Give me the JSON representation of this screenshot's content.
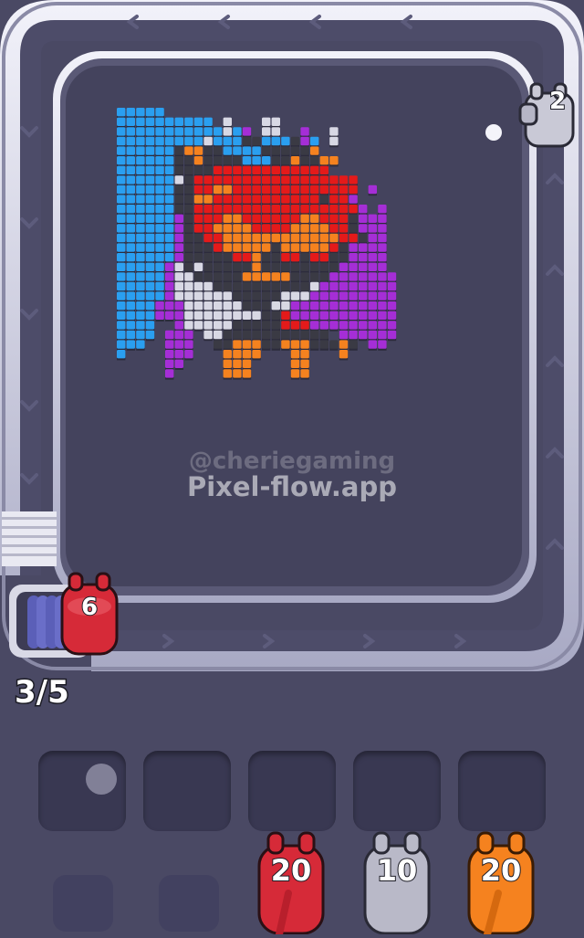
{
  "watermark": {
    "handle": "@cheriegaming",
    "site": "Pixel-flow.app"
  },
  "conveyor": {
    "shooter": {
      "count": "2",
      "color": "#b9b9c8"
    },
    "active_shooter": {
      "count": "6",
      "color": "#d62a38"
    },
    "progress": "3/5"
  },
  "queue_units": [
    {
      "count": "20",
      "color": "#d62a38"
    },
    {
      "count": "10",
      "color": "#b9b9c8"
    },
    {
      "count": "20",
      "color": "#f5821f"
    }
  ],
  "slots": {
    "count": 5
  },
  "palette": {
    "B": "#2a9ff0",
    "D": "#3a3a44",
    "W": "#d8d8e4",
    "O": "#f5821f",
    "R": "#e41a1a",
    "P": "#a52ed6"
  },
  "pixel_art": [
    "BBBBB.........................",
    "BBBBBBBBBB.W...WW.............",
    "BBBBBBBBBBBWBP.WW..P..W.......",
    "BBBBBBBBBWBBBDDBBBDPB.W.......",
    "BBBBBBDOODDBBBBDDDDDO.........",
    "BBBBBBDDODDDDBBBDDODDOO.......",
    "BBBBBBDDDDRRRRRRRRRRRR........",
    "BBBBBBWDRRRRRRRRRRRRRRRRR.....",
    "BBBBBBDDRROORRRRRRRRRRRRR.P...",
    "BBBBBBDDOORRRRRRRRRRRDRRP.....",
    "BBBBBBDDRRRRRRRRRRRRRRRRRP.P..",
    "BBBBBBPDRRROORRRRRROORRRDPPP..",
    "BBBBBBPDRROOOORRRROOOORRDPPP..",
    "BBBBBBPDDRROOOOOOOOOOOORRDPP..",
    "BBBBBBPDDDROOOOODOOOOORDPPPP..",
    "BBBBBBPDDDDDRRODDRRDRRDDPPPP..",
    "BBBBBPWDWDDDDDODDDDDDDDPPPPP..",
    "BBBBBPWWDDDDDOOOOODDDDPPPPPPP.",
    "BBBBBPWWWWDDDDDDDDDDWPPPPPPPP.",
    "BBBBBPWWWWWWDDDDDWWWPPPPPPPPP.",
    "BBBBPPPWWWWWWDDDWWPPPPPPPPPPP.",
    "BBBBPPPWWWWWWWWDDRPPPPPPPPPPP.",
    "BBBB..PWWWWWDDDDDRRRPPPPPPPPP.",
    "BBBB.PPP.WWDDDDDDDDDDD.PPPPPP.",
    "BBB..PPP..DDOOODDOOODDDOD.PP..",
    "B....PPP...OOOO...OO...O......",
    ".....PP....OOO....OO..........",
    ".....P.....OOO....OO.........."
  ]
}
